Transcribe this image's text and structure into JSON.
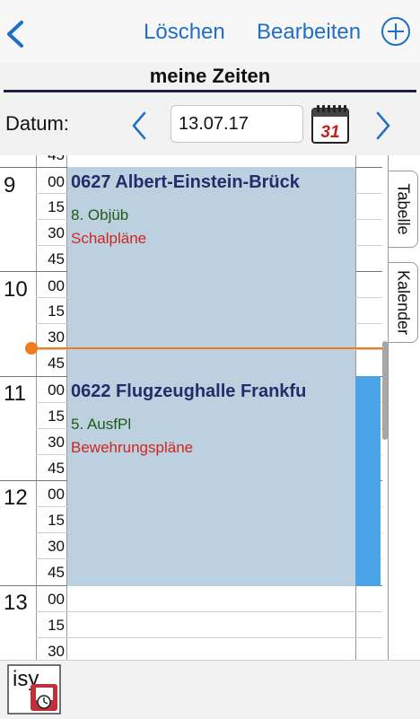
{
  "nav": {
    "delete_label": "Löschen",
    "edit_label": "Bearbeiten",
    "back_icon": "chevron-left-icon",
    "add_icon": "plus-circle-icon",
    "accent_color": "#1f6fc5"
  },
  "title": "meine Zeiten",
  "datebar": {
    "label": "Datum:",
    "date_value": "13.07.17",
    "calendar_day": "31"
  },
  "grid": {
    "top_partial_minute": "45",
    "hours": [
      {
        "hour": "9",
        "minutes": [
          "00",
          "15",
          "30",
          "45"
        ]
      },
      {
        "hour": "10",
        "minutes": [
          "00",
          "15",
          "30",
          "45"
        ]
      },
      {
        "hour": "11",
        "minutes": [
          "00",
          "15",
          "30",
          "45"
        ]
      },
      {
        "hour": "12",
        "minutes": [
          "00",
          "15",
          "30",
          "45"
        ]
      },
      {
        "hour": "13",
        "minutes": [
          "00",
          "15",
          "30"
        ]
      }
    ]
  },
  "events": [
    {
      "title": "0627 Albert-Einstein-Brück",
      "subtitle": "8. Objüb",
      "detail": "Schalpläne",
      "color": "#bcd0e0"
    },
    {
      "title": "0622 Flugzeughalle Frankfu",
      "subtitle": "5. AusfPl",
      "detail": "Bewehrungspläne",
      "color": "#bcd0e0"
    }
  ],
  "tabs": {
    "table": "Tabelle",
    "calendar": "Kalender"
  },
  "bottom": {
    "logo_text": "isy"
  },
  "colors": {
    "now_indicator": "#f07b1a",
    "event_stripe": "#4aa3e6"
  }
}
